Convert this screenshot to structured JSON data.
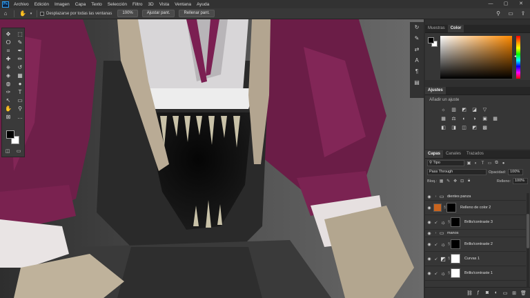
{
  "menubar": {
    "logo": "Ps",
    "items": [
      "Archivo",
      "Edición",
      "Imagen",
      "Capa",
      "Texto",
      "Selección",
      "Filtro",
      "3D",
      "Vista",
      "Ventana",
      "Ayuda"
    ],
    "window_controls": [
      "—",
      "▢",
      "✕"
    ]
  },
  "options": {
    "scroll_all_label": "Desplazarse por todas las ventanas",
    "zoom_value": "100%",
    "fit_screen": "Ajustar pant.",
    "fill_screen": "Rellenar pant."
  },
  "colors": {
    "accent": "#31a8ff",
    "thumb_fill": "#c8641e",
    "mask_white": "#ffffff",
    "mask_black": "#000000"
  },
  "tools": {
    "icons": [
      "move-icon",
      "marquee-icon",
      "lasso-icon",
      "brush-select-icon",
      "crop-icon",
      "eyedropper-icon",
      "healing-icon",
      "brush-icon",
      "stamp-icon",
      "history-brush-icon",
      "eraser-icon",
      "gradient-icon",
      "blur-icon",
      "dodge-icon",
      "pen-icon",
      "type-icon",
      "path-select-icon",
      "shape-icon",
      "hand-icon",
      "zoom-icon",
      "frame-icon",
      "more-icon"
    ],
    "glyphs": [
      "✥",
      "⬚",
      "ⵔ",
      "✎",
      "⌗",
      "✒",
      "✚",
      "✏",
      "⎈",
      "↺",
      "◈",
      "▦",
      "◍",
      "●",
      "✑",
      "T",
      "↖",
      "▭",
      "✋",
      "⚲",
      "⊠",
      "…"
    ]
  },
  "panels": {
    "color_tabs": [
      "Muestras",
      "Color"
    ],
    "adjust_title": "Ajustes",
    "adjust_subtitle": "Añadir un ajuste",
    "adjust_icons": [
      "☼",
      "▥",
      "◩",
      "◪",
      "▽",
      "",
      "▦",
      "⚖",
      "◐",
      "◑",
      "▣",
      "▦",
      "◧",
      "◨",
      "◫",
      "◩",
      "▩",
      ""
    ],
    "layers_tabs": [
      "Capas",
      "Canales",
      "Trazados"
    ],
    "kind_filter": "Tipo",
    "blend_mode": "Pass Through",
    "opacity_label": "Opacidad:",
    "opacity_value": "100%",
    "lock_label": "Bloq.:",
    "fill_label": "Relleno:",
    "fill_value": "100%"
  },
  "layers": [
    {
      "type": "group",
      "name": "dientes panza"
    },
    {
      "type": "fill",
      "name": "Relleno de color 2"
    },
    {
      "type": "adjust",
      "name": "Brillo/contraste 3",
      "mask": "black"
    },
    {
      "type": "group",
      "name": "manos"
    },
    {
      "type": "adjust",
      "name": "Brillo/contraste 2",
      "mask": "black"
    },
    {
      "type": "adjust",
      "name": "Curvas 1",
      "mask": "white"
    },
    {
      "type": "adjust",
      "name": "Brillo/contraste 1",
      "mask": "white"
    }
  ]
}
